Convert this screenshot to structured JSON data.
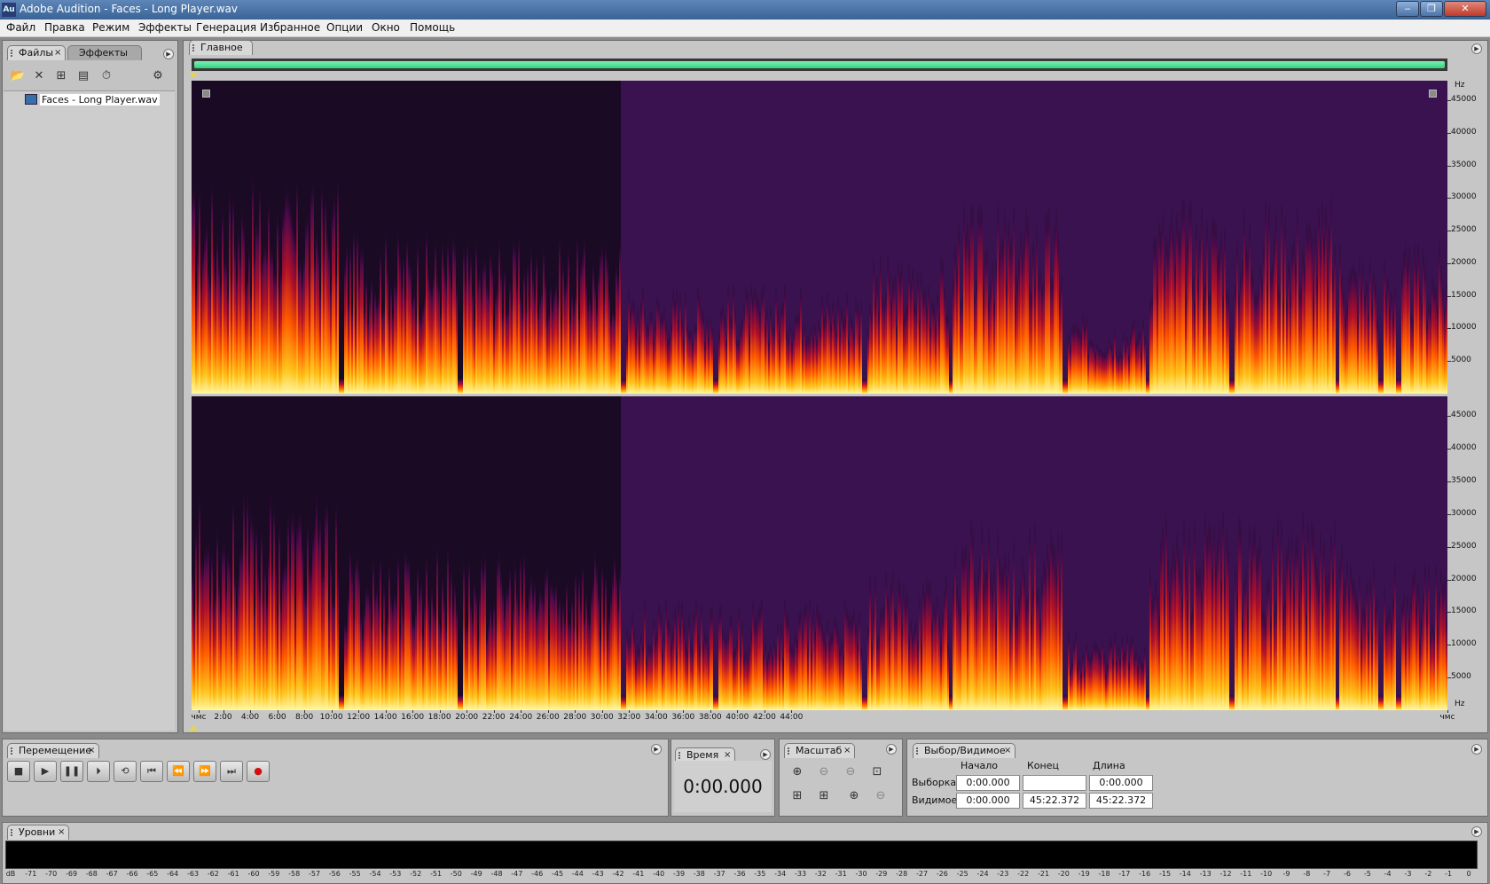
{
  "window": {
    "app_icon": "Au",
    "title": "Adobe Audition - Faces - Long Player.wav",
    "minimize": "‒",
    "maximize": "❐",
    "close": "✕"
  },
  "menu": [
    "Файл",
    "Правка",
    "Режим",
    "Эффекты",
    "Генерация",
    "Избранное",
    "Опции",
    "Окно",
    "Помощь"
  ],
  "files_panel": {
    "tabs": [
      "Файлы",
      "Эффекты"
    ],
    "items": [
      "Faces - Long Player.wav"
    ]
  },
  "main_panel": {
    "tab": "Главное",
    "freq_unit": "Hz",
    "freq_labels": [
      "45000",
      "40000",
      "35000",
      "30000",
      "25000",
      "20000",
      "15000",
      "10000",
      "5000"
    ],
    "time_labels": [
      "чмс",
      "2:00",
      "4:00",
      "6:00",
      "8:00",
      "10:00",
      "12:00",
      "14:00",
      "16:00",
      "18:00",
      "20:00",
      "22:00",
      "24:00",
      "26:00",
      "28:00",
      "30:00",
      "32:00",
      "34:00",
      "36:00",
      "38:00",
      "40:00",
      "42:00",
      "44:00",
      "чмс"
    ]
  },
  "transport": {
    "tab": "Перемещение",
    "buttons": [
      "stop",
      "play",
      "pause",
      "play-loop",
      "loop",
      "go-to-start",
      "rewind",
      "fast-forward",
      "go-to-end",
      "record"
    ]
  },
  "time_panel": {
    "tab": "Время",
    "value": "0:00.000"
  },
  "zoom_panel": {
    "tab": "Масштаб"
  },
  "selection_panel": {
    "tab": "Выбор/Видимое",
    "headers": [
      "Начало",
      "Конец",
      "Длина"
    ],
    "rows": [
      {
        "label": "Выборка",
        "start": "0:00.000",
        "end": "",
        "length": "0:00.000"
      },
      {
        "label": "Видимое",
        "start": "0:00.000",
        "end": "45:22.372",
        "length": "45:22.372"
      }
    ]
  },
  "levels": {
    "tab": "Уровни",
    "scale": [
      "dB",
      "-71",
      "-70",
      "-69",
      "-68",
      "-67",
      "-66",
      "-65",
      "-64",
      "-63",
      "-62",
      "-61",
      "-60",
      "-59",
      "-58",
      "-57",
      "-56",
      "-55",
      "-54",
      "-53",
      "-52",
      "-51",
      "-50",
      "-49",
      "-48",
      "-47",
      "-46",
      "-45",
      "-44",
      "-43",
      "-42",
      "-41",
      "-40",
      "-39",
      "-38",
      "-37",
      "-36",
      "-35",
      "-34",
      "-33",
      "-32",
      "-31",
      "-30",
      "-29",
      "-28",
      "-27",
      "-26",
      "-25",
      "-24",
      "-23",
      "-22",
      "-21",
      "-20",
      "-19",
      "-18",
      "-17",
      "-16",
      "-15",
      "-14",
      "-13",
      "-12",
      "-11",
      "-10",
      "-9",
      "-8",
      "-7",
      "-6",
      "-5",
      "-4",
      "-3",
      "-2",
      "-1",
      "0"
    ]
  }
}
